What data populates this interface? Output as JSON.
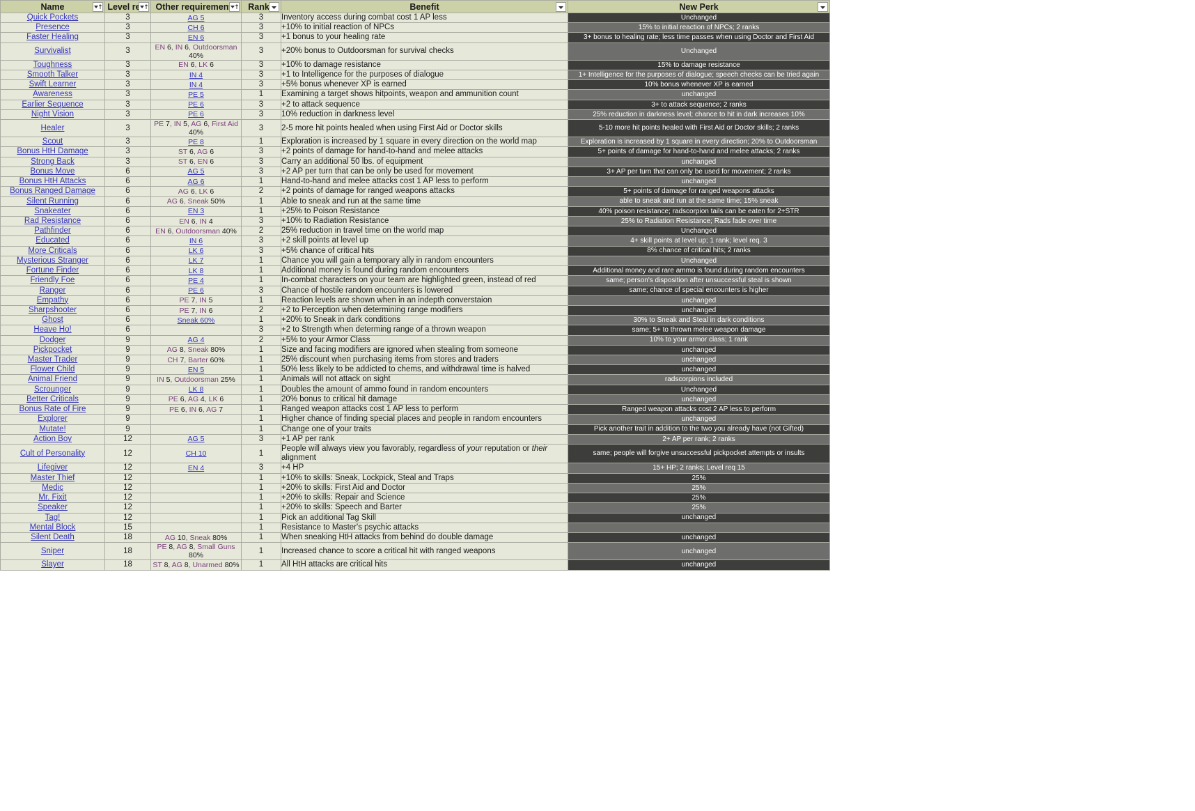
{
  "table": {
    "columns": [
      {
        "key": "name",
        "label": "Name",
        "filter": true,
        "sorted": true
      },
      {
        "key": "level",
        "label": "Level req.",
        "filter": true,
        "sorted": true
      },
      {
        "key": "req",
        "label": "Other requirements",
        "filter": true,
        "sorted": true
      },
      {
        "key": "ranks",
        "label": "Ranks",
        "filter": true,
        "sorted": false
      },
      {
        "key": "benefit",
        "label": "Benefit",
        "filter": true,
        "sorted": false
      },
      {
        "key": "perk",
        "label": "New Perk",
        "filter": true,
        "sorted": false
      }
    ],
    "colors": {
      "header_bg": "#ccd1a8",
      "cell_bg": "#e6e8da",
      "border": "#a9aba1",
      "perk_dark": "#3d3d3b",
      "perk_light": "#6e6e6c",
      "link": "#3333bb",
      "requirement_text": "#7a3f7a"
    },
    "rows": [
      {
        "name": "Quick Pockets",
        "level": "3",
        "req": "AG 5",
        "req_link": true,
        "ranks": "3",
        "benefit": "Inventory access during combat cost 1 AP less",
        "perk": "Unchanged"
      },
      {
        "name": "Presence",
        "level": "3",
        "req": "CH 6",
        "req_link": true,
        "ranks": "3",
        "benefit": "+10% to initial reaction of NPCs",
        "perk": "15% to initial reaction of NPCs; 2 ranks"
      },
      {
        "name": "Faster Healing",
        "level": "3",
        "req": "EN 6",
        "req_link": true,
        "ranks": "3",
        "benefit": "+1 bonus to your healing rate",
        "perk": "3+ bonus to healing rate; less time passes when using Doctor and First Aid"
      },
      {
        "name": "Survivalist",
        "level": "3",
        "req": "EN 6, IN 6, Outdoorsman 40%",
        "req_link": false,
        "ranks": "3",
        "benefit": "+20% bonus to Outdoorsman for survival checks",
        "perk": "Unchanged"
      },
      {
        "name": "Toughness",
        "level": "3",
        "req": "EN 6, LK 6",
        "req_link": false,
        "ranks": "3",
        "benefit": "+10% to damage resistance",
        "perk": "15% to damage resistance"
      },
      {
        "name": "Smooth Talker",
        "level": "3",
        "req": "IN 4",
        "req_link": true,
        "ranks": "3",
        "benefit": "+1 to Intelligence for the purposes of dialogue",
        "perk": "1+ Intelligence for the purposes of dialogue; speech checks can be tried again"
      },
      {
        "name": "Swift Learner",
        "level": "3",
        "req": "IN 4",
        "req_link": true,
        "ranks": "3",
        "benefit": "+5% bonus whenever XP is earned",
        "perk": "10% bonus whenever XP is earned"
      },
      {
        "name": "Awareness",
        "level": "3",
        "req": "PE 5",
        "req_link": true,
        "ranks": "1",
        "benefit": "Examining a target shows hitpoints, weapon and ammunition count",
        "perk": "unchanged"
      },
      {
        "name": "Earlier Sequence",
        "level": "3",
        "req": "PE 6",
        "req_link": true,
        "ranks": "3",
        "benefit": "+2 to attack sequence",
        "perk": "3+ to attack sequence; 2 ranks"
      },
      {
        "name": "Night Vision",
        "level": "3",
        "req": "PE 6",
        "req_link": true,
        "ranks": "3",
        "benefit": "10% reduction in darkness level",
        "perk": "25% reduction in darkness level; chance to hit in dark increases 10%"
      },
      {
        "name": "Healer",
        "level": "3",
        "req": "PE 7, IN 5, AG 6, First Aid 40%",
        "req_link": false,
        "ranks": "3",
        "benefit": "2-5 more hit points healed when using First Aid or Doctor skills",
        "perk": "5-10 more hit points healed with First Aid or Doctor skills; 2 ranks"
      },
      {
        "name": "Scout",
        "level": "3",
        "req": "PE 8",
        "req_link": true,
        "ranks": "1",
        "benefit": "Exploration is increased by 1 square in every direction on the world map",
        "perk": "Exploration is increased by 1 square in every direction; 20% to Outdoorsman"
      },
      {
        "name": "Bonus HtH Damage",
        "level": "3",
        "req": "ST 6, AG 6",
        "req_link": false,
        "ranks": "3",
        "benefit": "+2 points of damage for hand-to-hand and melee attacks",
        "perk": "5+ points of damage for hand-to-hand and melee attacks; 2 ranks"
      },
      {
        "name": "Strong Back",
        "level": "3",
        "req": "ST 6, EN 6",
        "req_link": false,
        "ranks": "3",
        "benefit": "Carry an additional 50 lbs. of equipment",
        "perk": "unchanged"
      },
      {
        "name": "Bonus Move",
        "level": "6",
        "req": "AG 5",
        "req_link": true,
        "ranks": "3",
        "benefit": "+2 AP per turn that can be only be used for movement",
        "perk": "3+ AP per turn that can only be used for movement; 2 ranks"
      },
      {
        "name": "Bonus HtH Attacks",
        "level": "6",
        "req": "AG 6",
        "req_link": true,
        "ranks": "1",
        "benefit": "Hand-to-hand and melee attacks cost 1 AP less to perform",
        "perk": "unchanged"
      },
      {
        "name": "Bonus Ranged Damage",
        "level": "6",
        "req": "AG 6, LK 6",
        "req_link": false,
        "ranks": "2",
        "benefit": "+2 points of damage for ranged weapons attacks",
        "perk": "5+ points of damage for ranged weapons attacks"
      },
      {
        "name": "Silent Running",
        "level": "6",
        "req": "AG 6, Sneak 50%",
        "req_link": false,
        "ranks": "1",
        "benefit": "Able to sneak and run at the same time",
        "perk": "able to sneak and run at the same time; 15% sneak"
      },
      {
        "name": "Snakeater",
        "level": "6",
        "req": "EN 3",
        "req_link": true,
        "ranks": "1",
        "benefit": "+25% to Poison Resistance",
        "perk": "40% poison resistance; radscorpion tails can be eaten for 2+STR"
      },
      {
        "name": "Rad Resistance",
        "level": "6",
        "req": "EN 6, IN 4",
        "req_link": false,
        "ranks": "3",
        "benefit": "+10% to Radiation Resistance",
        "perk": "25% to Radiation Resistance; Rads fade over time"
      },
      {
        "name": "Pathfinder",
        "level": "6",
        "req": "EN 6, Outdoorsman 40%",
        "req_link": false,
        "ranks": "2",
        "benefit": "25% reduction in travel time on the world map",
        "perk": "Unchanged"
      },
      {
        "name": "Educated",
        "level": "6",
        "req": "IN 6",
        "req_link": true,
        "ranks": "3",
        "benefit": "+2 skill points at level up",
        "perk": "4+ skill points at level up; 1 rank; level req. 3"
      },
      {
        "name": "More Criticals",
        "level": "6",
        "req": "LK 6",
        "req_link": true,
        "ranks": "3",
        "benefit": "+5% chance of critical hits",
        "perk": "8% chance of critical hits; 2 ranks"
      },
      {
        "name": "Mysterious Stranger",
        "level": "6",
        "req": "LK 7",
        "req_link": true,
        "ranks": "1",
        "benefit": "Chance you will gain a temporary ally in random encounters",
        "perk": "Unchanged"
      },
      {
        "name": "Fortune Finder",
        "level": "6",
        "req": "LK 8",
        "req_link": true,
        "ranks": "1",
        "benefit": "Additional money is found during random encounters",
        "perk": "Additional money and rare ammo is found during random encounters"
      },
      {
        "name": "Friendly Foe",
        "level": "6",
        "req": "PE 4",
        "req_link": true,
        "ranks": "1",
        "benefit": "In-combat characters on your team are highlighted green, instead of red",
        "perk": "same; person's disposition after unsuccessful steal is shown"
      },
      {
        "name": "Ranger",
        "level": "6",
        "req": "PE 6",
        "req_link": true,
        "ranks": "3",
        "benefit": "Chance of hostile random encounters is lowered",
        "perk": "same; chance of special encounters is higher"
      },
      {
        "name": "Empathy",
        "level": "6",
        "req": "PE 7, IN 5",
        "req_link": false,
        "ranks": "1",
        "benefit": "Reaction levels are shown when in an indepth converstaion",
        "perk": "unchanged"
      },
      {
        "name": "Sharpshooter",
        "level": "6",
        "req": "PE 7, IN 6",
        "req_link": false,
        "ranks": "2",
        "benefit": "+2 to Perception when determining range modifiers",
        "perk": "unchanged"
      },
      {
        "name": "Ghost",
        "level": "6",
        "req": "Sneak 60%",
        "req_link": true,
        "ranks": "1",
        "benefit": "+20% to Sneak in dark conditions",
        "perk": "30% to Sneak and Steal in dark conditions"
      },
      {
        "name": "Heave Ho!",
        "level": "6",
        "req": "",
        "req_link": false,
        "ranks": "3",
        "benefit": "+2 to Strength when determing range of a thrown weapon",
        "perk": "same; 5+ to thrown melee weapon damage"
      },
      {
        "name": "Dodger",
        "level": "9",
        "req": "AG 4",
        "req_link": true,
        "ranks": "2",
        "benefit": "+5% to your Armor Class",
        "perk": "10% to your armor class; 1 rank"
      },
      {
        "name": "Pickpocket",
        "level": "9",
        "req": "AG 8, Sneak 80%",
        "req_link": false,
        "ranks": "1",
        "benefit": "Size and facing modifiers are ignored when stealing from someone",
        "perk": "unchanged"
      },
      {
        "name": "Master Trader",
        "level": "9",
        "req": "CH 7, Barter 60%",
        "req_link": false,
        "ranks": "1",
        "benefit": "25% discount when purchasing items from stores and traders",
        "perk": "unchanged"
      },
      {
        "name": "Flower Child",
        "level": "9",
        "req": "EN 5",
        "req_link": true,
        "ranks": "1",
        "benefit": "50% less likely to be addicted to chems, and withdrawal time is halved",
        "perk": "unchanged"
      },
      {
        "name": "Animal Friend",
        "level": "9",
        "req": "IN 5, Outdoorsman 25%",
        "req_link": false,
        "ranks": "1",
        "benefit": "Animals will not attack on sight",
        "perk": "radscorpions included"
      },
      {
        "name": "Scrounger",
        "level": "9",
        "req": "LK 8",
        "req_link": true,
        "ranks": "1",
        "benefit": "Doubles the amount of ammo found in random encounters",
        "perk": "Unchanged"
      },
      {
        "name": "Better Criticals",
        "level": "9",
        "req": "PE 6, AG 4, LK 6",
        "req_link": false,
        "ranks": "1",
        "benefit": "20% bonus to critical hit damage",
        "perk": "unchanged"
      },
      {
        "name": "Bonus Rate of Fire",
        "level": "9",
        "req": "PE 6, IN 6, AG 7",
        "req_link": false,
        "ranks": "1",
        "benefit": "Ranged weapon attacks cost 1 AP less to perform",
        "perk": "Ranged weapon attacks cost 2 AP less to perform"
      },
      {
        "name": "Explorer",
        "level": "9",
        "req": "",
        "req_link": false,
        "ranks": "1",
        "benefit": "Higher chance of finding special places and people in random encounters",
        "perk": "unchanged"
      },
      {
        "name": "Mutate!",
        "level": "9",
        "req": "",
        "req_link": false,
        "ranks": "1",
        "benefit": "Change one of your traits",
        "perk": "Pick another trait in addition to the two you already have (not Gifted)"
      },
      {
        "name": "Action Boy",
        "level": "12",
        "req": "AG 5",
        "req_link": true,
        "ranks": "3",
        "benefit": "+1 AP per rank",
        "perk": "2+ AP per rank; 2 ranks"
      },
      {
        "name": "Cult of Personality",
        "level": "12",
        "req": "CH 10",
        "req_link": true,
        "ranks": "1",
        "benefit": "People will always view you favorably, regardless of your reputation or their alignment",
        "benefit_italic": [
          "your",
          "their"
        ],
        "perk": "same; people will forgive unsuccessful pickpocket attempts or insults"
      },
      {
        "name": "Lifegiver",
        "level": "12",
        "req": "EN 4",
        "req_link": true,
        "ranks": "3",
        "benefit": "+4 HP",
        "perk": "15+ HP; 2 ranks; Level req 15"
      },
      {
        "name": "Master Thief",
        "level": "12",
        "req": "",
        "req_link": false,
        "ranks": "1",
        "benefit": "+10% to skills: Sneak, Lockpick, Steal and Traps",
        "perk": "25%"
      },
      {
        "name": "Medic",
        "level": "12",
        "req": "",
        "req_link": false,
        "ranks": "1",
        "benefit": "+20% to skills: First Aid and Doctor",
        "perk": "25%"
      },
      {
        "name": "Mr. Fixit",
        "level": "12",
        "req": "",
        "req_link": false,
        "ranks": "1",
        "benefit": "+20% to skills: Repair and Science",
        "perk": "25%"
      },
      {
        "name": "Speaker",
        "level": "12",
        "req": "",
        "req_link": false,
        "ranks": "1",
        "benefit": "+20% to skills: Speech and Barter",
        "perk": "25%"
      },
      {
        "name": "Tag!",
        "level": "12",
        "req": "",
        "req_link": false,
        "ranks": "1",
        "benefit": "Pick an additional Tag Skill",
        "perk": "unchanged"
      },
      {
        "name": "Mental Block",
        "level": "15",
        "req": "",
        "req_link": false,
        "ranks": "1",
        "benefit": "Resistance to Master's psychic attacks",
        "perk": ""
      },
      {
        "name": "Silent Death",
        "level": "18",
        "req": "AG 10, Sneak 80%",
        "req_link": false,
        "ranks": "1",
        "benefit": "When sneaking HtH attacks from behind do double damage",
        "perk": "unchanged"
      },
      {
        "name": "Sniper",
        "level": "18",
        "req": "PE 8, AG 8, Small Guns 80%",
        "req_link": false,
        "ranks": "1",
        "benefit": "Increased chance to score a critical hit with ranged weapons",
        "perk": "unchanged"
      },
      {
        "name": "Slayer",
        "level": "18",
        "req": "ST 8, AG 8, Unarmed 80%",
        "req_link": false,
        "ranks": "1",
        "benefit": "All HtH attacks are critical hits",
        "perk": "unchanged"
      }
    ]
  }
}
